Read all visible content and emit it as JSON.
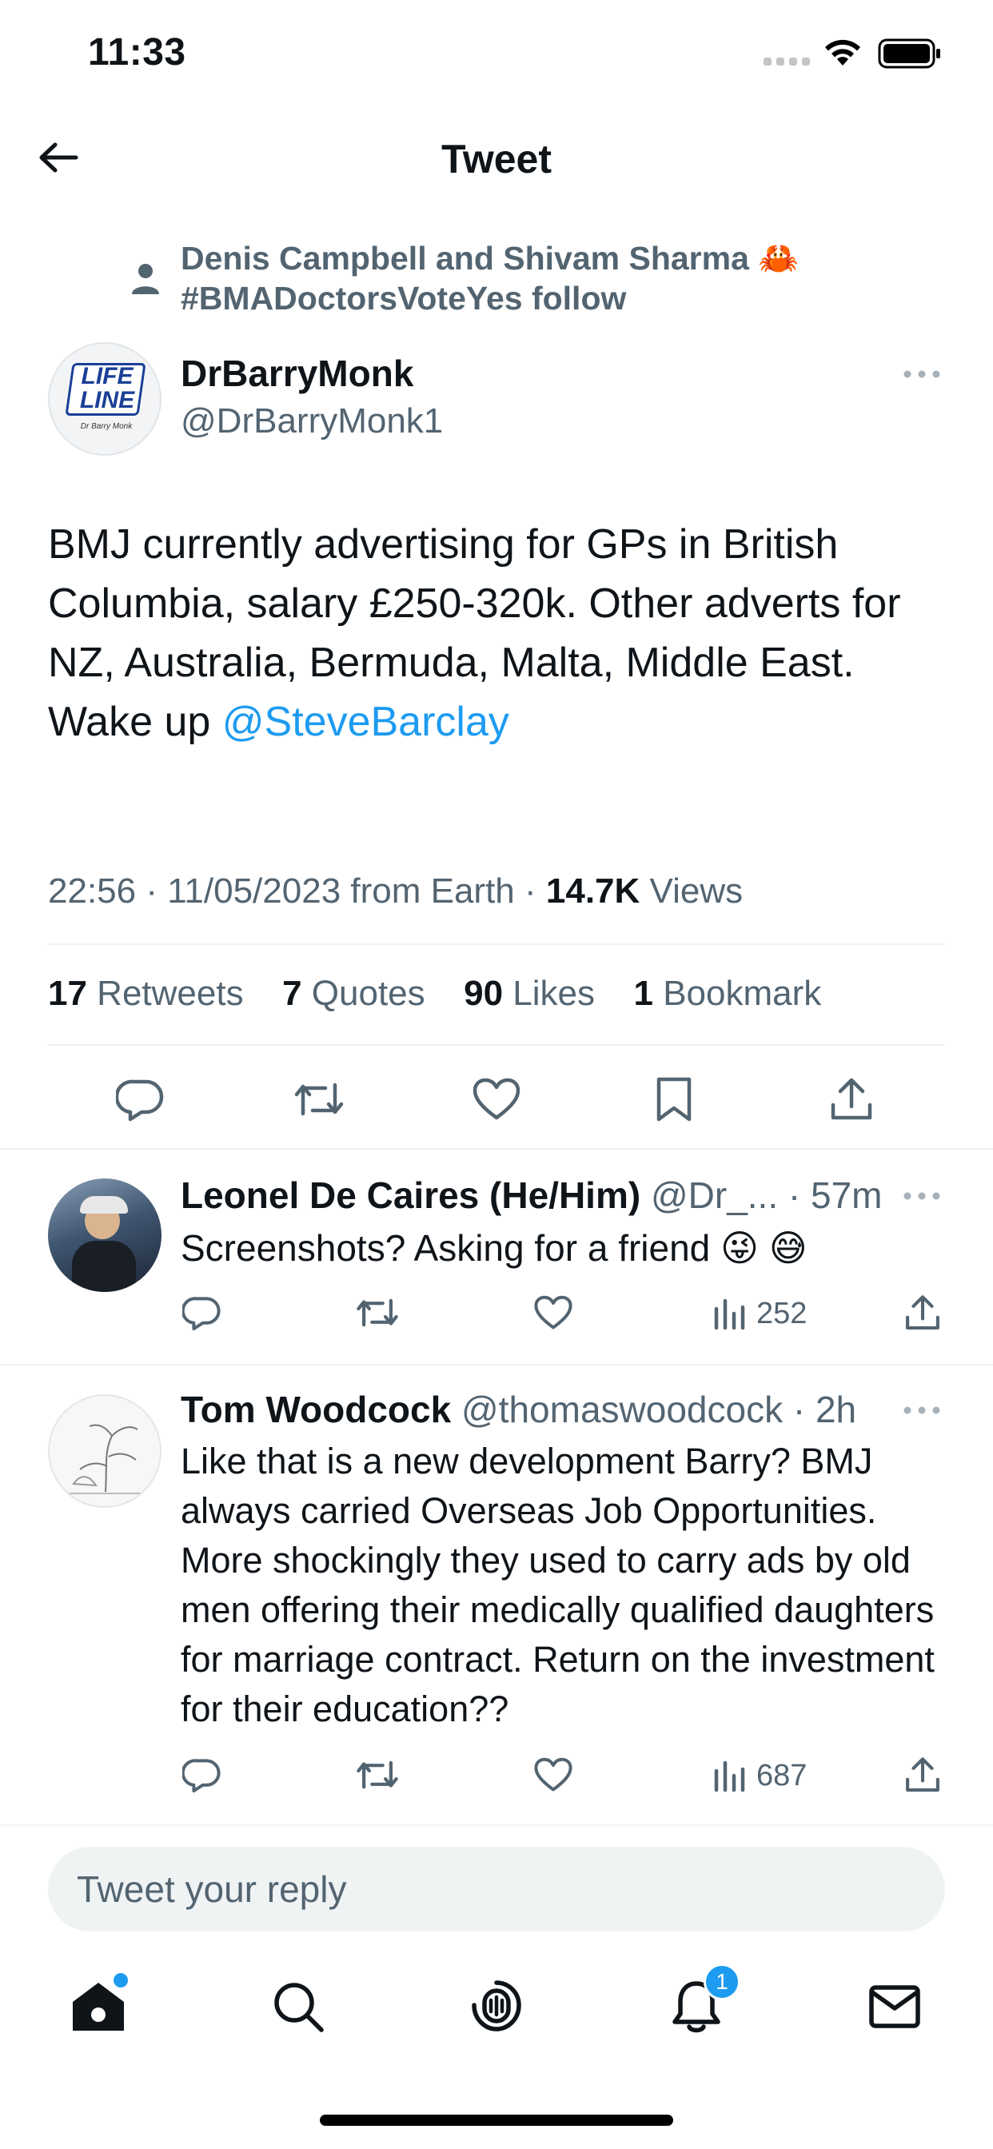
{
  "status_bar": {
    "time": "11:33"
  },
  "header": {
    "title": "Tweet"
  },
  "social_context": {
    "text": "Denis Campbell and Shivam Sharma 🦀 #BMADoctorsVoteYes follow"
  },
  "tweet": {
    "author_name": "DrBarryMonk",
    "author_handle": "@DrBarryMonk1",
    "avatar_text_1": "LIFE",
    "avatar_text_2": "LINE",
    "avatar_text_3": "Dr Barry Monk",
    "body": "BMJ currently advertising for GPs in British Columbia, salary £250-320k. Other adverts for NZ, Australia, Bermuda, Malta, Middle East.",
    "body_line2_prefix": "Wake up ",
    "mention": "@SteveBarclay",
    "meta": "22:56 · 11/05/2023 from Earth · ",
    "views_count": "14.7K",
    "views_label": " Views",
    "stats": [
      {
        "count": "17",
        "label": " Retweets"
      },
      {
        "count": "7",
        "label": " Quotes"
      },
      {
        "count": "90",
        "label": " Likes"
      },
      {
        "count": "1",
        "label": " Bookmark"
      }
    ]
  },
  "replies": [
    {
      "name": "Leonel De Caires (He/Him)",
      "handle": "@Dr_... · 57m",
      "text": "Screenshots? Asking for a friend 😜 😅",
      "views": "252"
    },
    {
      "name": "Tom Woodcock",
      "handle": "@thomaswoodcock · 2h",
      "text": "Like that is a new development Barry? BMJ always carried Overseas Job Opportunities. More shockingly they used to carry ads by old men offering their medically qualified daughters for marriage contract. Return on the investment for their education??",
      "views": "687"
    }
  ],
  "composer": {
    "placeholder": "Tweet your reply"
  },
  "tab_bar": {
    "notification_badge": "1"
  },
  "colors": {
    "accent": "#1d9bf0",
    "text": "#0f1419",
    "muted": "#536471",
    "divider": "#eff3f4"
  }
}
